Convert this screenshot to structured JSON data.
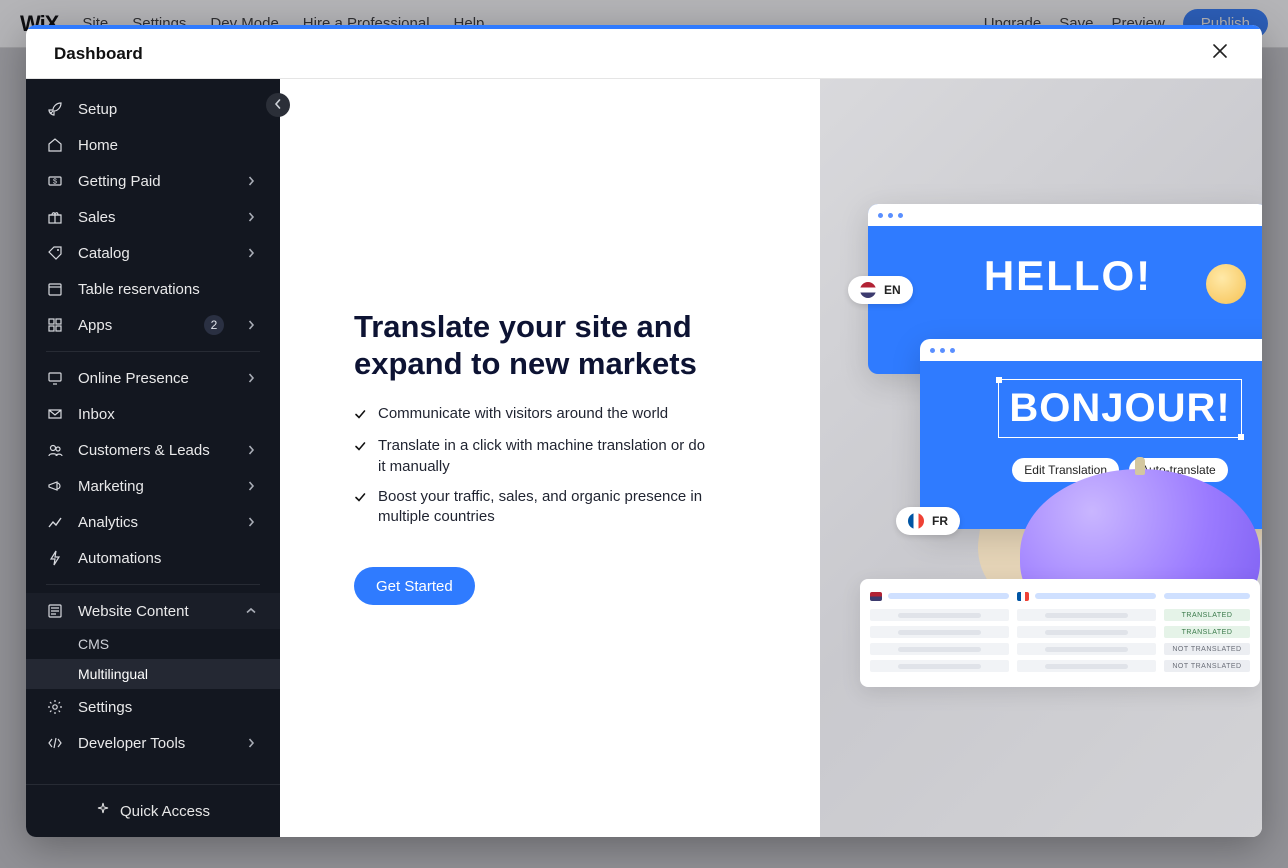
{
  "bg_menu": {
    "site": "Site",
    "settings": "Settings",
    "dev": "Dev Mode",
    "hire": "Hire a Professional",
    "help": "Help",
    "upgrade": "Upgrade",
    "save": "Save",
    "preview": "Preview",
    "publish": "Publish",
    "wix": "WiX"
  },
  "modal": {
    "title": "Dashboard"
  },
  "sidebar": {
    "items": [
      {
        "key": "setup",
        "label": "Setup",
        "chev": false
      },
      {
        "key": "home",
        "label": "Home",
        "chev": false
      },
      {
        "key": "getting-paid",
        "label": "Getting Paid",
        "chev": true
      },
      {
        "key": "sales",
        "label": "Sales",
        "chev": true
      },
      {
        "key": "catalog",
        "label": "Catalog",
        "chev": true
      },
      {
        "key": "table-res",
        "label": "Table reservations",
        "chev": false
      },
      {
        "key": "apps",
        "label": "Apps",
        "chev": true,
        "badge": "2"
      }
    ],
    "items2": [
      {
        "key": "online-presence",
        "label": "Online Presence",
        "chev": true
      },
      {
        "key": "inbox",
        "label": "Inbox",
        "chev": false
      },
      {
        "key": "customers",
        "label": "Customers & Leads",
        "chev": true
      },
      {
        "key": "marketing",
        "label": "Marketing",
        "chev": true
      },
      {
        "key": "analytics",
        "label": "Analytics",
        "chev": true
      },
      {
        "key": "automations",
        "label": "Automations",
        "chev": false
      }
    ],
    "website_content": {
      "label": "Website Content",
      "sub": [
        {
          "key": "cms",
          "label": "CMS",
          "active": false
        },
        {
          "key": "multilingual",
          "label": "Multilingual",
          "active": true
        }
      ]
    },
    "items3": [
      {
        "key": "settings",
        "label": "Settings",
        "chev": false
      },
      {
        "key": "devtools",
        "label": "Developer Tools",
        "chev": true
      }
    ],
    "quick_access": "Quick Access"
  },
  "content": {
    "heading": "Translate your site and expand to new markets",
    "bullets": [
      "Communicate with visitors around the world",
      "Translate in a click with machine translation or do it manually",
      "Boost your traffic, sales, and organic presence in multiple countries"
    ],
    "cta": "Get Started"
  },
  "promo": {
    "hello": "HELLO!",
    "bonjour": "BONJOUR!",
    "edit": "Edit Translation",
    "auto": "Auto-translate",
    "en": "EN",
    "fr": "FR",
    "translated": "TRANSLATED",
    "not_translated": "NOT TRANSLATED"
  }
}
